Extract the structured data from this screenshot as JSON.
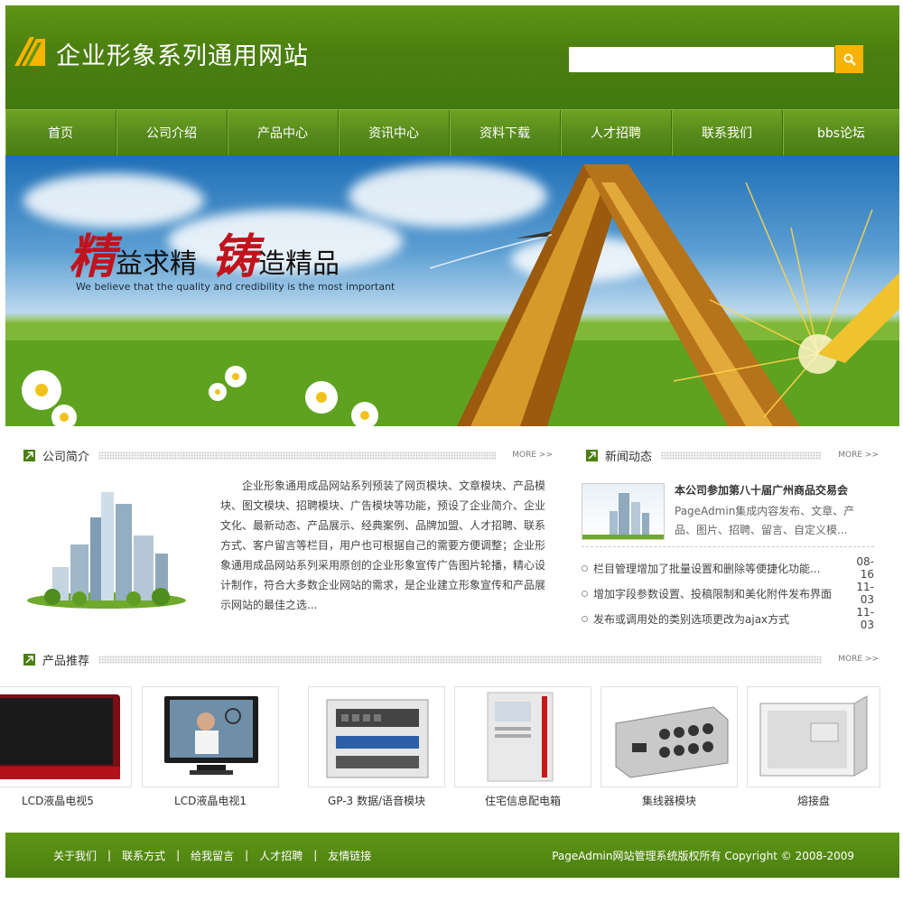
{
  "header": {
    "site_title": "企业形象系列通用网站",
    "search_placeholder": ""
  },
  "nav": [
    "首页",
    "公司介绍",
    "产品中心",
    "资讯中心",
    "资料下载",
    "人才招聘",
    "联系我们",
    "bbs论坛"
  ],
  "banner": {
    "char1": "精",
    "text1": "益求精",
    "char2": "铸",
    "text2": "造精品",
    "subtitle": "We believe that the quality and credibility is the most important"
  },
  "about": {
    "title": "公司简介",
    "more": "MORE >>",
    "text": "企业形象通用成品网站系列预装了网页模块、文章模块、产品模块、图文模块、招聘模块、广告模块等功能，预设了企业简介、企业文化、最新动态、产品展示、经典案例、品牌加盟、人才招聘、联系方式、客户留言等栏目，用户也可根据自己的需要方便调整；企业形象通用成品网站系列采用原创的企业形象宣传广告图片轮播，精心设计制作，符合大多数企业网站的需求，是企业建立形象宣传和产品展示网站的最佳之选..."
  },
  "news": {
    "title": "新闻动态",
    "more": "MORE >>",
    "featured_title": "本公司参加第八十届广州商品交易会",
    "featured_desc": "PageAdmin集成内容发布、文章、产品、图片、招聘、留言、自定义模...",
    "items": [
      {
        "text": "栏目管理增加了批量设置和删除等便捷化功能...",
        "date": "08-16"
      },
      {
        "text": "增加字段参数设置、投稿限制和美化附件发布界面",
        "date": "11-03"
      },
      {
        "text": "发布或调用处的类别选项更改为ajax方式",
        "date": "11-03"
      }
    ]
  },
  "products": {
    "title": "产品推荐",
    "more": "MORE >>",
    "items": [
      {
        "label": "LCD液晶电视5",
        "icon": "red-lcd-tv-icon"
      },
      {
        "label": "LCD液晶电视1",
        "icon": "lcd-tv-tennis-icon"
      },
      {
        "label": "GP-3 数据/语音模块",
        "icon": "patch-panel-icon"
      },
      {
        "label": "住宅信息配电箱",
        "icon": "distribution-box-icon"
      },
      {
        "label": "集线器模块",
        "icon": "hub-module-icon"
      },
      {
        "label": "熔接盘",
        "icon": "splice-tray-icon"
      }
    ]
  },
  "footer": {
    "links": [
      "关于我们",
      "联系方式",
      "给我留言",
      "人才招聘",
      "友情链接"
    ],
    "separator": "|",
    "copyright": "PageAdmin网站管理系统版权所有 Copyright © 2008-2009"
  },
  "colors": {
    "brand_green": "#4b7f10",
    "search_button": "#f7b300",
    "slogan_red": "#c0141d"
  }
}
